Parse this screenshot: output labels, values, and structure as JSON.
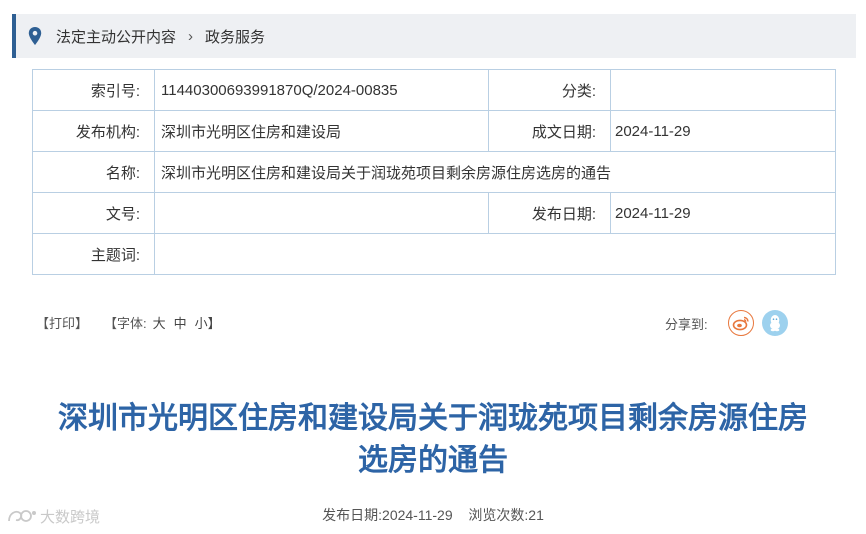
{
  "breadcrumb": {
    "items": [
      "法定主动公开内容",
      "政务服务"
    ],
    "separator": "›"
  },
  "meta": {
    "index_label": "索引号:",
    "index_value": "11440300693991870Q/2024-00835",
    "category_label": "分类:",
    "category_value": "",
    "publisher_label": "发布机构:",
    "publisher_value": "深圳市光明区住房和建设局",
    "created_label": "成文日期:",
    "created_value": "2024-11-29",
    "name_label": "名称:",
    "name_value": "深圳市光明区住房和建设局关于润珑苑项目剩余房源住房选房的通告",
    "docno_label": "文号:",
    "docno_value": "",
    "pubdate_label": "发布日期:",
    "pubdate_value": "2024-11-29",
    "keywords_label": "主题词:",
    "keywords_value": ""
  },
  "toolbar": {
    "print": "【打印】",
    "font_open": "【字体:",
    "font_large": "大",
    "font_medium": "中",
    "font_small": "小】",
    "share_label": "分享到:"
  },
  "article": {
    "title_line1": "深圳市光明区住房和建设局关于润珑苑项目剩余房源住房",
    "title_line2": "选房的通告",
    "pub_date": "发布日期:2024-11-29",
    "views": "浏览次数:21"
  },
  "watermark": "大数跨境",
  "colors": {
    "accent": "#2e5f93",
    "title": "#2d64a6",
    "table_border": "#b9cfe3",
    "weibo": "#e8773d",
    "qq": "#9dd1ee"
  },
  "icons": [
    "location-pin-icon",
    "weibo-icon",
    "qq-icon",
    "watermark-logo-icon"
  ]
}
